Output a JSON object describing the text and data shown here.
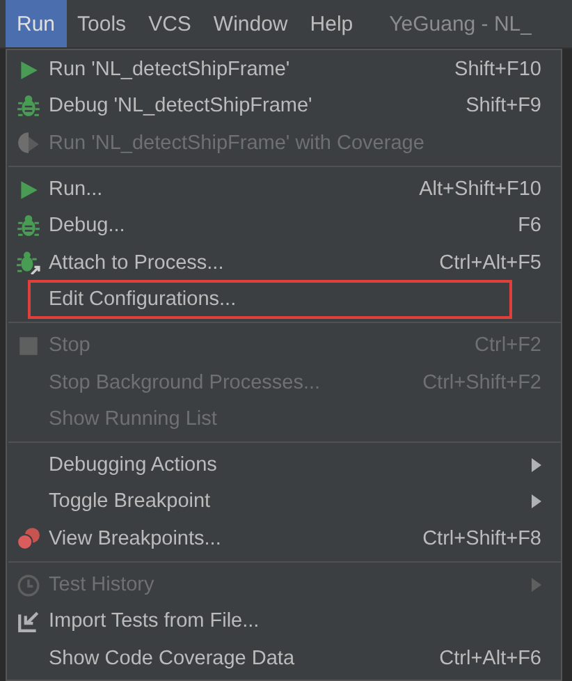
{
  "menu_bar": {
    "items": [
      {
        "label": "Run",
        "selected": true
      },
      {
        "label": "Tools",
        "selected": false
      },
      {
        "label": "VCS",
        "selected": false
      },
      {
        "label": "Window",
        "selected": false
      },
      {
        "label": "Help",
        "selected": false
      }
    ],
    "window_title": "YeGuang - NL_"
  },
  "menu": {
    "groups": [
      {
        "items": [
          {
            "kind": "run",
            "label": "Run 'NL_detectShipFrame'",
            "shortcut": "Shift+F10",
            "disabled": false,
            "submenu": false,
            "outlined": false
          },
          {
            "kind": "debug",
            "label": "Debug 'NL_detectShipFrame'",
            "shortcut": "Shift+F9",
            "disabled": false,
            "submenu": false,
            "outlined": false
          },
          {
            "kind": "coverage",
            "label": "Run 'NL_detectShipFrame' with Coverage",
            "disabled": true,
            "submenu": false,
            "outlined": false
          }
        ]
      },
      {
        "items": [
          {
            "kind": "run",
            "label": "Run...",
            "shortcut": "Alt+Shift+F10",
            "disabled": false,
            "submenu": false,
            "outlined": false
          },
          {
            "kind": "debug",
            "label": "Debug...",
            "shortcut": "F6",
            "disabled": false,
            "submenu": false,
            "outlined": false
          },
          {
            "kind": "attach",
            "label": "Attach to Process...",
            "shortcut": "Ctrl+Alt+F5",
            "disabled": false,
            "submenu": false,
            "outlined": false
          },
          {
            "kind": "plain",
            "label": "Edit Configurations...",
            "disabled": false,
            "submenu": false,
            "outlined": true
          }
        ]
      },
      {
        "items": [
          {
            "kind": "stop",
            "label": "Stop",
            "shortcut": "Ctrl+F2",
            "disabled": true,
            "submenu": false,
            "outlined": false
          },
          {
            "kind": "plain",
            "label": "Stop Background Processes...",
            "shortcut": "Ctrl+Shift+F2",
            "disabled": true,
            "submenu": false,
            "outlined": false
          },
          {
            "kind": "plain",
            "label": "Show Running List",
            "disabled": true,
            "submenu": false,
            "outlined": false
          }
        ]
      },
      {
        "items": [
          {
            "kind": "plain",
            "label": "Debugging Actions",
            "disabled": false,
            "submenu": true,
            "outlined": false
          },
          {
            "kind": "plain",
            "label": "Toggle Breakpoint",
            "disabled": false,
            "submenu": true,
            "outlined": false
          },
          {
            "kind": "breakpoints",
            "label": "View Breakpoints...",
            "shortcut": "Ctrl+Shift+F8",
            "disabled": false,
            "submenu": false,
            "outlined": false
          }
        ]
      },
      {
        "items": [
          {
            "kind": "history",
            "label": "Test History",
            "disabled": true,
            "submenu": true,
            "outlined": false
          },
          {
            "kind": "import",
            "label": "Import Tests from File...",
            "disabled": false,
            "submenu": false,
            "outlined": false
          },
          {
            "kind": "plain",
            "label": "Show Code Coverage Data",
            "shortcut": "Ctrl+Alt+F6",
            "disabled": false,
            "submenu": false,
            "outlined": false
          }
        ]
      }
    ]
  }
}
